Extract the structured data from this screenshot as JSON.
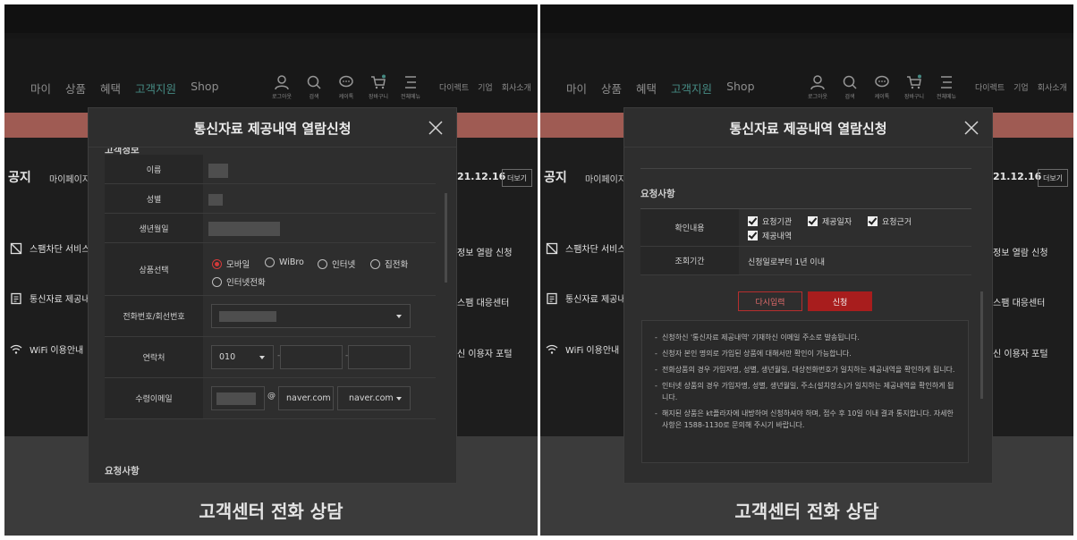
{
  "colors": {
    "accent": "#6ad3c8",
    "banner": "#f48c80",
    "primary_red": "#a81d1d"
  },
  "site": {
    "menu": [
      "마이",
      "상품",
      "혜택",
      "고객지원",
      "Shop"
    ],
    "menu_active": "고객지원",
    "icons": [
      {
        "icon": "user-icon",
        "label": "로그아웃"
      },
      {
        "icon": "search-icon",
        "label": "검색"
      },
      {
        "icon": "chat-icon",
        "label": "케이톡"
      },
      {
        "icon": "cart-icon",
        "label": "장바구니"
      },
      {
        "icon": "menu-icon",
        "label": "전체메뉴"
      }
    ],
    "util_links": [
      "다이렉트",
      "기업",
      "회사소개"
    ],
    "notice_title": "공지",
    "notice_sub": "마이페이지",
    "notice_date": "21.12.16",
    "more_label": "더보기",
    "services_left": [
      "스팸차단 서비스",
      "통신자료 제공내",
      "WiFi 이용안내"
    ],
    "services_right": [
      "정보 열람 신청",
      "스팸 대응센터",
      "신 이용자 포털"
    ],
    "bottom_title": "고객센터 전화 상담"
  },
  "modal_left": {
    "title": "통신자료 제공내역 열람신청",
    "section_cut_top": "고객정보",
    "fields": {
      "name": "이름",
      "gender": "성별",
      "birth": "생년월일",
      "product": "상품선택",
      "phone": "전화번호/회선번호",
      "contact": "연락처",
      "email": "수령이메일"
    },
    "product_options": [
      "모바일",
      "WiBro",
      "인터넷",
      "집전화",
      "인터넷전화"
    ],
    "product_selected": "모바일",
    "contact_prefix": "010",
    "email_at": "@",
    "email_domain": "naver.com",
    "email_domain_select": "naver.com",
    "section_cut_bottom": "요청사항"
  },
  "modal_right": {
    "title": "통신자료 제공내역 열람신청",
    "section": "요청사항",
    "confirm_label": "확인내용",
    "checks": [
      "요청기관",
      "제공일자",
      "요청근거",
      "제공내역"
    ],
    "period_label": "조회기간",
    "period_value": "신청일로부터 1년 이내",
    "reset_button": "다시입력",
    "submit_button": "신청",
    "notes": [
      "신청하신 '통신자료 제공내역' 기재하신 이메일 주소로 발송됩니다.",
      "신청자 본인 명의로 가입된 상품에 대해서만 확인이 가능합니다.",
      "전화상품의 경우 가입자명, 성별, 생년월일, 대상전화번호가 일치하는 제공내역을 확인하게 됩니다.",
      "인터넷 상품의 경우 가입자명, 성별, 생년월일, 주소(설치장소)가 일치하는 제공내역을 확인하게 됩니다.",
      "해지된 상품은 kt플라자에 내방하여 신청하셔야 하며, 접수 후 10일 이내 결과 통지합니다. 자세한 사항은 1588-1130로 문의해 주시기 바랍니다."
    ]
  }
}
